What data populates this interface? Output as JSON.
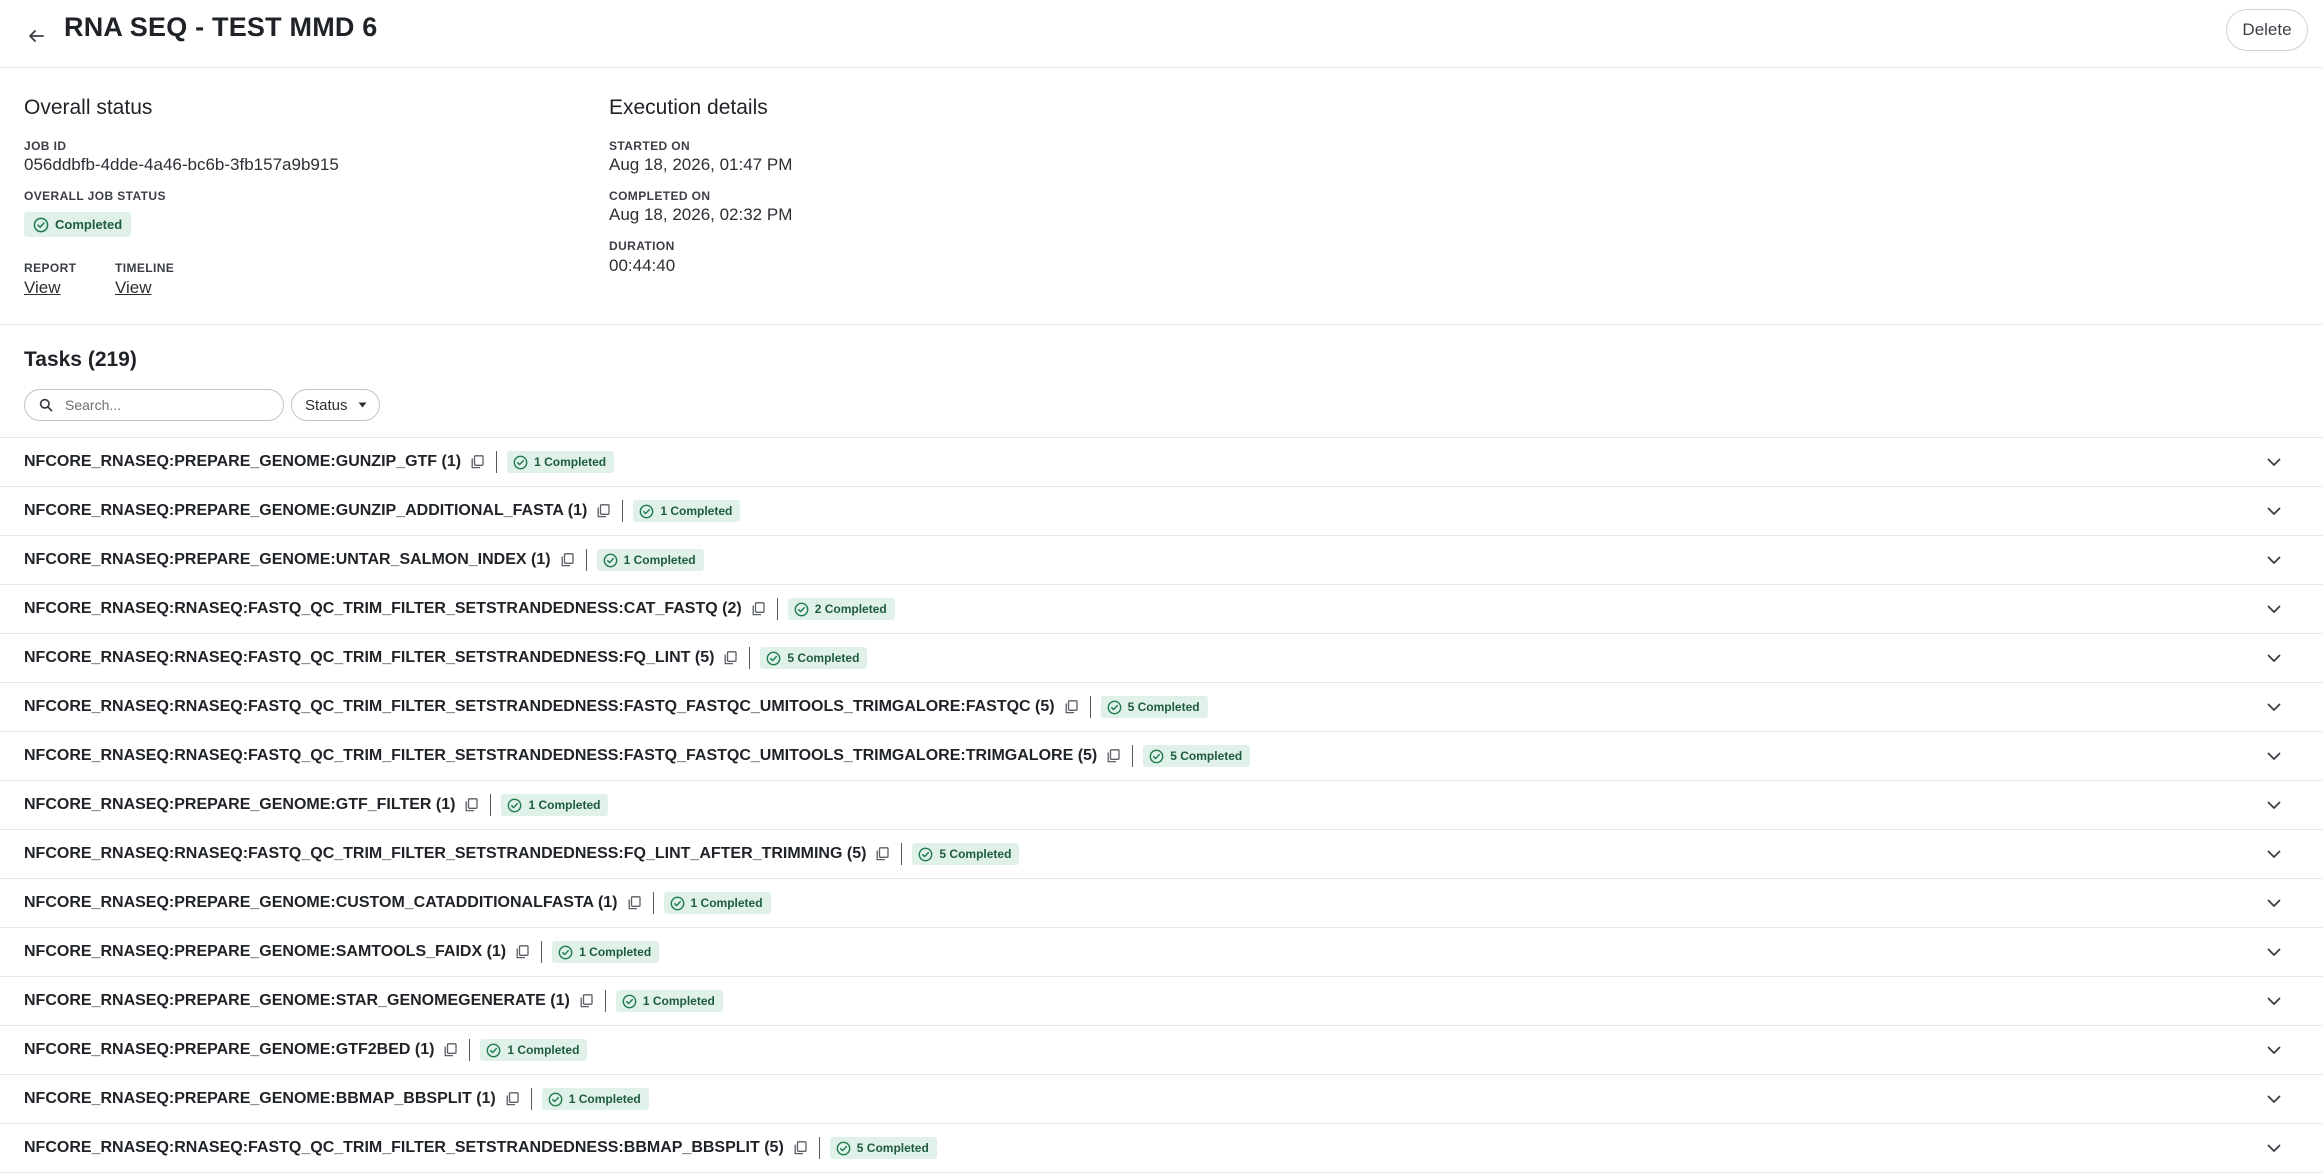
{
  "header": {
    "title": "RNA SEQ - TEST MMD 6",
    "delete_label": "Delete"
  },
  "overall": {
    "section_title": "Overall status",
    "job_id_label": "JOB ID",
    "job_id": "056ddbfb-4dde-4a46-bc6b-3fb157a9b915",
    "job_status_label": "OVERALL JOB STATUS",
    "job_status": "Completed",
    "report_label": "REPORT",
    "report_link": "View",
    "timeline_label": "TIMELINE",
    "timeline_link": "View"
  },
  "execution": {
    "section_title": "Execution details",
    "started_label": "STARTED ON",
    "started": "Aug 18, 2026, 01:47 PM",
    "completed_label": "COMPLETED ON",
    "completed": "Aug 18, 2026, 02:32 PM",
    "duration_label": "DURATION",
    "duration": "00:44:40"
  },
  "tasks": {
    "title": "Tasks (219)",
    "search_placeholder": "Search...",
    "status_filter_label": "Status",
    "items": [
      {
        "name": "NFCORE_RNASEQ:PREPARE_GENOME:GUNZIP_GTF (1)",
        "badge": "1 Completed"
      },
      {
        "name": "NFCORE_RNASEQ:PREPARE_GENOME:GUNZIP_ADDITIONAL_FASTA (1)",
        "badge": "1 Completed"
      },
      {
        "name": "NFCORE_RNASEQ:PREPARE_GENOME:UNTAR_SALMON_INDEX (1)",
        "badge": "1 Completed"
      },
      {
        "name": "NFCORE_RNASEQ:RNASEQ:FASTQ_QC_TRIM_FILTER_SETSTRANDEDNESS:CAT_FASTQ (2)",
        "badge": "2 Completed"
      },
      {
        "name": "NFCORE_RNASEQ:RNASEQ:FASTQ_QC_TRIM_FILTER_SETSTRANDEDNESS:FQ_LINT (5)",
        "badge": "5 Completed"
      },
      {
        "name": "NFCORE_RNASEQ:RNASEQ:FASTQ_QC_TRIM_FILTER_SETSTRANDEDNESS:FASTQ_FASTQC_UMITOOLS_TRIMGALORE:FASTQC (5)",
        "badge": "5 Completed"
      },
      {
        "name": "NFCORE_RNASEQ:RNASEQ:FASTQ_QC_TRIM_FILTER_SETSTRANDEDNESS:FASTQ_FASTQC_UMITOOLS_TRIMGALORE:TRIMGALORE (5)",
        "badge": "5 Completed"
      },
      {
        "name": "NFCORE_RNASEQ:PREPARE_GENOME:GTF_FILTER (1)",
        "badge": "1 Completed"
      },
      {
        "name": "NFCORE_RNASEQ:RNASEQ:FASTQ_QC_TRIM_FILTER_SETSTRANDEDNESS:FQ_LINT_AFTER_TRIMMING (5)",
        "badge": "5 Completed"
      },
      {
        "name": "NFCORE_RNASEQ:PREPARE_GENOME:CUSTOM_CATADDITIONALFASTA (1)",
        "badge": "1 Completed"
      },
      {
        "name": "NFCORE_RNASEQ:PREPARE_GENOME:SAMTOOLS_FAIDX (1)",
        "badge": "1 Completed"
      },
      {
        "name": "NFCORE_RNASEQ:PREPARE_GENOME:STAR_GENOMEGENERATE (1)",
        "badge": "1 Completed"
      },
      {
        "name": "NFCORE_RNASEQ:PREPARE_GENOME:GTF2BED (1)",
        "badge": "1 Completed"
      },
      {
        "name": "NFCORE_RNASEQ:PREPARE_GENOME:BBMAP_BBSPLIT (1)",
        "badge": "1 Completed"
      },
      {
        "name": "NFCORE_RNASEQ:RNASEQ:FASTQ_QC_TRIM_FILTER_SETSTRANDEDNESS:BBMAP_BBSPLIT (5)",
        "badge": "5 Completed"
      }
    ]
  },
  "colors": {
    "badge_bg": "#dff1e8",
    "badge_text": "#1f5c3d",
    "badge_icon": "#1f7a4d"
  },
  "icons": [
    "back-arrow-icon",
    "check-circle-icon",
    "search-icon",
    "caret-down-icon",
    "copy-icon",
    "chevron-down-icon"
  ]
}
